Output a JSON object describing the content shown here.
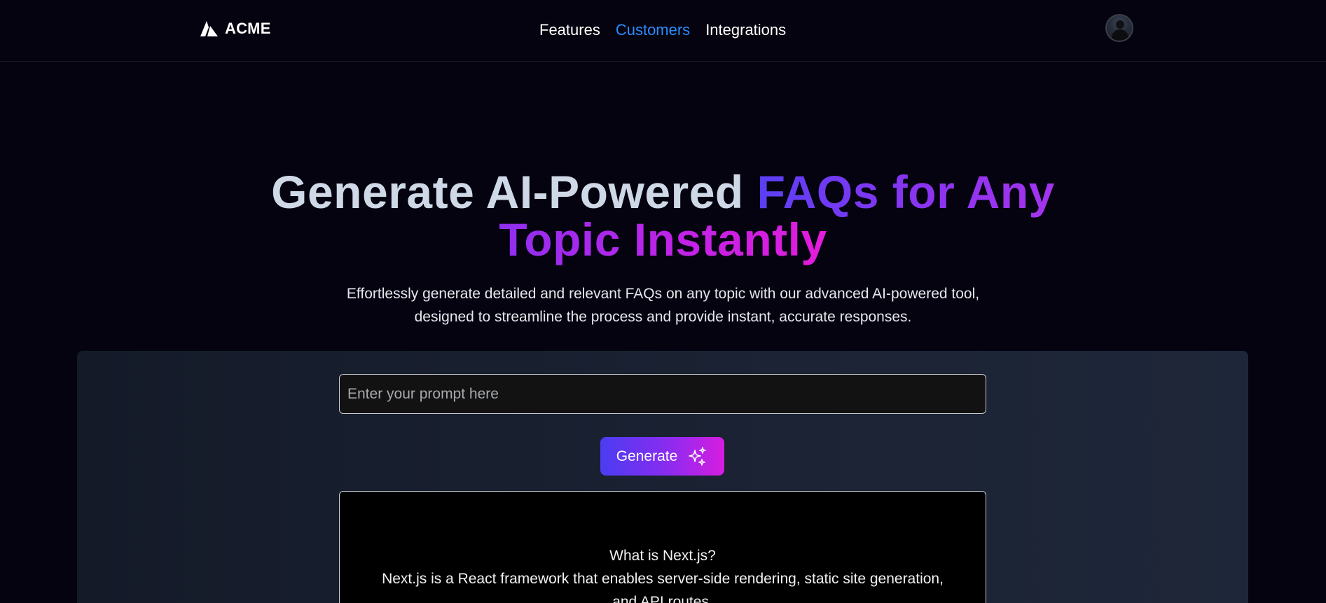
{
  "header": {
    "logo_text": "ACME",
    "nav": [
      {
        "label": "Features",
        "active": false
      },
      {
        "label": "Customers",
        "active": true
      },
      {
        "label": "Integrations",
        "active": false
      }
    ]
  },
  "hero": {
    "title_plain": "Generate AI-Powered ",
    "title_gradient_1": "FAQs for Any",
    "title_gradient_2": "Topic Instantly",
    "subtitle": "Effortlessly generate detailed and relevant FAQs on any topic with our advanced AI-powered tool, designed to streamline the process and provide instant, accurate responses."
  },
  "generator": {
    "prompt_placeholder": "Enter your prompt here",
    "prompt_value": "",
    "generate_label": "Generate"
  },
  "output": {
    "question": "What is Next.js?",
    "answer": "Next.js is a React framework that enables server-side rendering, static site generation, and API routes."
  },
  "colors": {
    "background": "#04030f",
    "nav_active": "#2d8cff",
    "gradient_start": "#4b3cf2",
    "gradient_end": "#e41bdc"
  }
}
